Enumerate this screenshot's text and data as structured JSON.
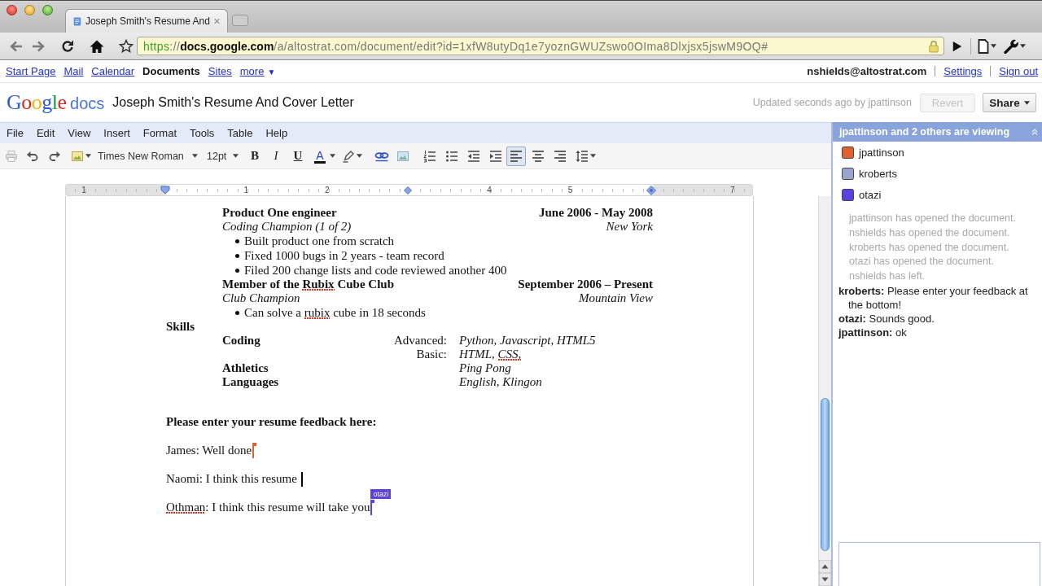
{
  "browser": {
    "tab": {
      "title": "Joseph Smith's Resume And"
    },
    "address": {
      "scheme": "https",
      "separator": "://",
      "host": "docs.google.com",
      "path": "/a/altostrat.com/document/edit?id=1xfW8utyDq1e7yoznGWUZswo0OIma8Dlxjsx5jswM9OQ#"
    }
  },
  "google_bar": {
    "links": [
      {
        "label": "Start Page",
        "selected": false
      },
      {
        "label": "Mail",
        "selected": false
      },
      {
        "label": "Calendar",
        "selected": false
      },
      {
        "label": "Documents",
        "selected": true
      },
      {
        "label": "Sites",
        "selected": false
      },
      {
        "label": "more",
        "selected": false,
        "caret": "▼"
      }
    ],
    "account": "nshields@altostrat.com",
    "account_links": [
      "Settings",
      "Sign out"
    ]
  },
  "header": {
    "logo": {
      "brand": "Google",
      "product": "docs"
    },
    "title": "Joseph Smith's Resume And Cover Letter",
    "status": "Updated seconds ago by jpattinson",
    "revert": {
      "label": "Revert",
      "disabled": true
    },
    "share": {
      "label": "Share"
    }
  },
  "menu": [
    "File",
    "Edit",
    "View",
    "Insert",
    "Format",
    "Tools",
    "Table",
    "Help"
  ],
  "toolbar": {
    "font": "Times New Roman",
    "font_size": "12pt",
    "bold": "B",
    "italic": "I",
    "underline": "U",
    "text_color": "A",
    "alignments": [
      {
        "selected": true
      },
      {
        "selected": false
      },
      {
        "selected": false
      }
    ]
  },
  "ruler": {
    "numbers": [
      "1",
      "1",
      "2",
      "4",
      "5",
      "7"
    ]
  },
  "document": {
    "entries": [
      {
        "title": "Product One engineer",
        "dates": "June 2006 - May 2008",
        "role": "Coding Champion (1 of 2)",
        "location": "New York",
        "bullets": [
          "Built product one from scratch",
          "Fixed 1000 bugs in 2 years - team record",
          "Filed 200 change lists and code reviewed another 400"
        ]
      },
      {
        "title": [
          {
            "text": "Member of the ",
            "misspelled": false
          },
          {
            "text": "Rubix",
            "misspelled": true
          },
          {
            "text": " Cube Club",
            "misspelled": false
          }
        ],
        "dates": "September 2006 – Present",
        "role": "Club Champion",
        "location": "Mountain View",
        "bullets": [
          [
            {
              "text": "Can solve a ",
              "misspelled": false
            },
            {
              "text": "rubix",
              "misspelled": true
            },
            {
              "text": " cube in 18 seconds",
              "misspelled": false
            }
          ]
        ]
      }
    ],
    "skills": {
      "heading": "Skills",
      "rows": [
        {
          "category": "Coding",
          "level": "Advanced:",
          "items": "Python, Javascript, HTML5"
        },
        {
          "level": "Basic:",
          "items": [
            {
              "text": "HTML, ",
              "misspelled": false
            },
            {
              "text": "CSS,",
              "misspelled": true
            }
          ]
        },
        {
          "category": "Athletics",
          "items": "Ping Pong"
        },
        {
          "category": "Languages",
          "items": "English, Klingon"
        }
      ]
    },
    "feedback": {
      "heading": "Please enter your resume feedback here:",
      "lines": [
        {
          "text": "James: Well done",
          "cursor": {
            "kind": "collaborator",
            "color": "#e0602e"
          }
        },
        {
          "text": "Naomi: I think this resume",
          "cursor": {
            "kind": "own",
            "color": "#000000"
          }
        },
        {
          "text": [
            {
              "text": "Othman",
              "misspelled": true
            },
            {
              "text": ": I think this resume will take you",
              "misspelled": false
            }
          ],
          "cursor": {
            "kind": "collaborator",
            "color": "#5b3fe0",
            "label": "otazi"
          }
        }
      ]
    }
  },
  "panel": {
    "viewers": {
      "title": "jpattinson and 2 others are viewing",
      "people": [
        {
          "name": "jpattinson",
          "color": "#e0602e"
        },
        {
          "name": "kroberts",
          "color": "#9aa3cc"
        },
        {
          "name": "otazi",
          "color": "#5b3fe0"
        }
      ]
    },
    "activity": [
      "jpattinson has opened the document.",
      "nshields has opened the document.",
      "kroberts has opened the document.",
      "otazi has opened the document.",
      "nshields has left."
    ],
    "chat": [
      "**kroberts:** Please enter your feedback at the bottom!",
      "**otazi:** Sounds good.",
      "**jpattinson:** ok"
    ]
  }
}
